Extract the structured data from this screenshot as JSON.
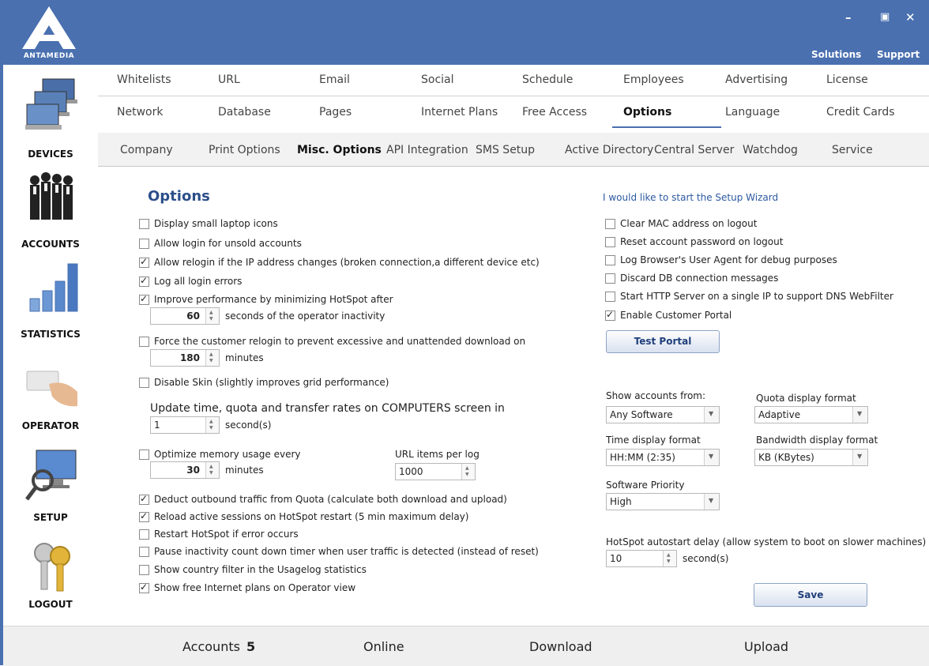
{
  "window": {
    "brand": "ANTAMEDIA",
    "minimize_glyph": "–",
    "restore_glyph": "▣",
    "close_glyph": "✕",
    "top_links": [
      "Solutions",
      "Support"
    ]
  },
  "nav": [
    {
      "label": "DEVICES",
      "icon": "devices-icon"
    },
    {
      "label": "ACCOUNTS",
      "icon": "accounts-icon"
    },
    {
      "label": "STATISTICS",
      "icon": "statistics-icon"
    },
    {
      "label": "OPERATOR",
      "icon": "operator-icon"
    },
    {
      "label": "SETUP",
      "icon": "setup-icon"
    },
    {
      "label": "LOGOUT",
      "icon": "logout-icon"
    }
  ],
  "tabs_row1": [
    "Whitelists",
    "URL",
    "Email",
    "Social",
    "Schedule",
    "Employees",
    "Advertising",
    "License"
  ],
  "tabs_row2": [
    "Network",
    "Database",
    "Pages",
    "Internet Plans",
    "Free Access",
    "Options",
    "Language",
    "Credit Cards"
  ],
  "active_tab": "Options",
  "subtabs": [
    "Company",
    "Print Options",
    "Misc. Options",
    "API Integration",
    "SMS Setup",
    "Active Directory",
    "Central Server",
    "Watchdog",
    "Service"
  ],
  "active_subtab": "Misc. Options",
  "heading": "Options",
  "left": {
    "cb_small_icons": "Display small laptop icons",
    "cb_unsold": "Allow login for unsold accounts",
    "cb_relogin_ip": "Allow relogin if the IP address changes (broken connection,a different device etc)",
    "cb_log_errors": "Log all login errors",
    "cb_improve": "Improve performance by minimizing HotSpot after",
    "inactivity_value": "60",
    "inactivity_unit": "seconds of the operator inactivity",
    "cb_force_relogin": "Force the customer relogin to prevent excessive and unattended download on",
    "relogin_value": "180",
    "relogin_unit": "minutes",
    "cb_disable_skin": "Disable Skin (slightly improves grid performance)",
    "update_label": "Update time, quota and transfer rates on COMPUTERS screen in",
    "update_value": "1",
    "update_unit": "second(s)",
    "cb_optimize": "Optimize memory usage every",
    "optimize_value": "30",
    "optimize_unit": "minutes",
    "url_items_label": "URL items per log",
    "url_items_value": "1000",
    "cb_deduct": "Deduct outbound traffic from Quota (calculate both download and upload)",
    "cb_reload": "Reload active sessions on HotSpot restart (5 min maximum delay)",
    "cb_restart": "Restart HotSpot if error occurs",
    "cb_pause": "Pause inactivity count down timer when user traffic is detected (instead of reset)",
    "cb_country": "Show country filter in the Usagelog statistics",
    "cb_free_plans": "Show free Internet plans on Operator view"
  },
  "right": {
    "wizard_link": "I would like to start the Setup Wizard",
    "cb_clear_mac": "Clear MAC address on logout",
    "cb_reset_pwd": "Reset account password on logout",
    "cb_user_agent": "Log Browser's User Agent for debug purposes",
    "cb_discard_db": "Discard DB connection messages",
    "cb_http_server": "Start HTTP Server on a single IP to support DNS WebFilter",
    "cb_portal": "Enable Customer Portal",
    "test_portal": "Test Portal",
    "show_accounts_label": "Show accounts from:",
    "show_accounts_value": "Any Software",
    "quota_format_label": "Quota display format",
    "quota_format_value": "Adaptive",
    "time_format_label": "Time display format",
    "time_format_value": "HH:MM  (2:35)",
    "bw_format_label": "Bandwidth display format",
    "bw_format_value": "KB (KBytes)",
    "priority_label": "Software Priority",
    "priority_value": "High",
    "autostart_label": "HotSpot autostart delay (allow system to boot on slower machines)",
    "autostart_value": "10",
    "autostart_unit": "second(s)",
    "save": "Save"
  },
  "checked": {
    "cb_small_icons": false,
    "cb_unsold": false,
    "cb_relogin_ip": true,
    "cb_log_errors": true,
    "cb_improve": true,
    "cb_force_relogin": false,
    "cb_disable_skin": false,
    "cb_optimize": false,
    "cb_deduct": true,
    "cb_reload": true,
    "cb_restart": false,
    "cb_pause": false,
    "cb_country": false,
    "cb_free_plans": true,
    "cb_clear_mac": false,
    "cb_reset_pwd": false,
    "cb_user_agent": false,
    "cb_discard_db": false,
    "cb_http_server": false,
    "cb_portal": true
  },
  "status": {
    "accounts_label": "Accounts",
    "accounts_count": "5",
    "online_label": "Online",
    "download_label": "Download",
    "upload_label": "Upload"
  },
  "colors": {
    "header": "#4a70b0",
    "heading": "#2c4f8a",
    "link": "#2c5aa0"
  }
}
